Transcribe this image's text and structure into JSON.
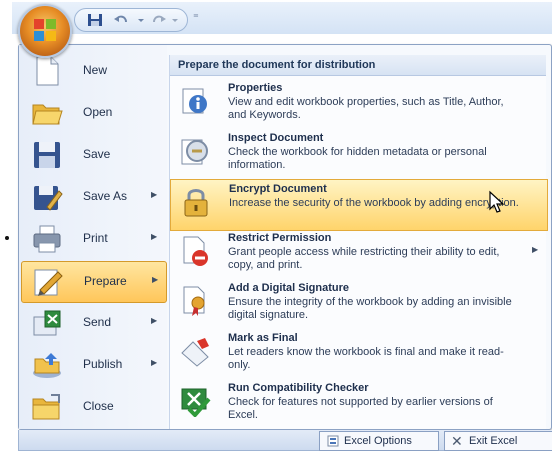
{
  "quick_access_toolbar": {
    "icons": [
      "office-button",
      "save-icon",
      "undo-icon",
      "redo-icon",
      "customize-icon"
    ],
    "customize_glyph": "⁼"
  },
  "left_menu": {
    "items": [
      {
        "label": "New",
        "icon": "new-document-icon",
        "has_submenu": false
      },
      {
        "label": "Open",
        "icon": "open-folder-icon",
        "has_submenu": false
      },
      {
        "label": "Save",
        "icon": "save-icon",
        "has_submenu": false
      },
      {
        "label": "Save As",
        "icon": "save-as-icon",
        "has_submenu": true
      },
      {
        "label": "Print",
        "icon": "printer-icon",
        "has_submenu": true
      },
      {
        "label": "Prepare",
        "icon": "prepare-icon",
        "has_submenu": true,
        "active": true
      },
      {
        "label": "Send",
        "icon": "send-icon",
        "has_submenu": true
      },
      {
        "label": "Publish",
        "icon": "publish-icon",
        "has_submenu": true
      },
      {
        "label": "Close",
        "icon": "close-folder-icon",
        "has_submenu": false
      }
    ],
    "submenu_arrow": "▶"
  },
  "right_panel": {
    "header": "Prepare the document for distribution",
    "items": [
      {
        "title": "Properties",
        "desc": "View and edit workbook properties, such as Title, Author, and Keywords.",
        "icon": "properties-icon"
      },
      {
        "title": "Inspect Document",
        "desc": "Check the workbook for hidden metadata or personal information.",
        "icon": "inspect-icon"
      },
      {
        "title": "Encrypt Document",
        "desc": "Increase the security of the workbook by adding encryption.",
        "icon": "lock-icon",
        "active": true
      },
      {
        "title": "Restrict Permission",
        "desc": "Grant people access while restricting their ability to edit, copy, and print.",
        "icon": "restrict-icon",
        "has_submenu": true
      },
      {
        "title": "Add a Digital Signature",
        "desc": "Ensure the integrity of the workbook by adding an invisible digital signature.",
        "icon": "signature-icon"
      },
      {
        "title": "Mark as Final",
        "desc": "Let readers know the workbook is final and make it read-only.",
        "icon": "mark-final-icon"
      },
      {
        "title": "Run Compatibility Checker",
        "desc": "Check for features not supported by earlier versions of Excel.",
        "icon": "compatibility-icon"
      }
    ]
  },
  "bottom_bar": {
    "options_label": "Excel Options",
    "exit_label": "Exit Excel",
    "exit_glyph": "✕"
  },
  "colors": {
    "highlight": "#ffc65a",
    "menu_bg": "#f6f9fd",
    "border": "#8ca2c4"
  }
}
